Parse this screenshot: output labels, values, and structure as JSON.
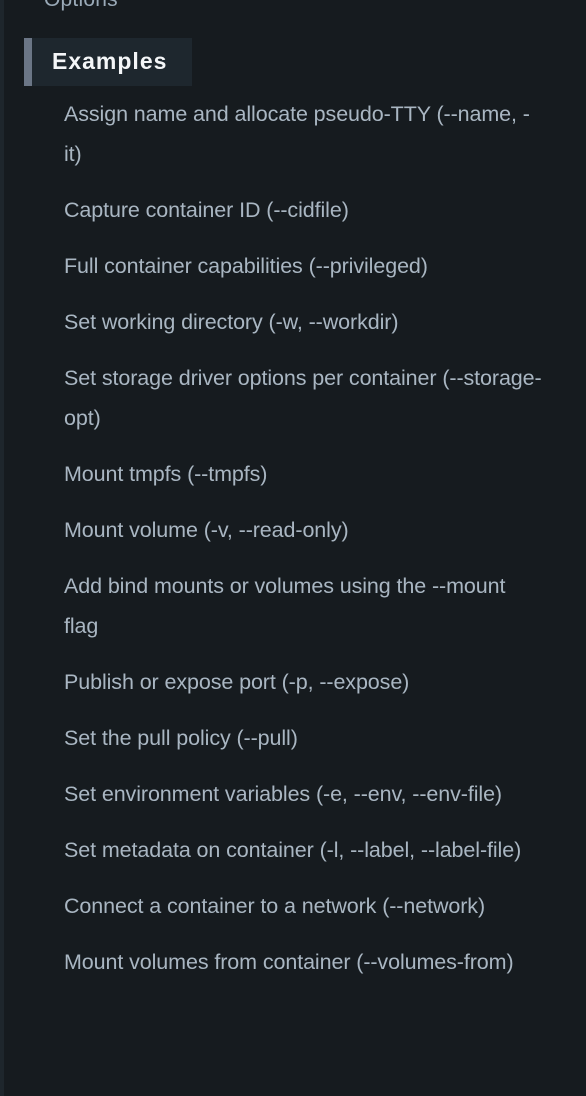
{
  "toc": {
    "previous_item": "Options",
    "active_section": "Examples",
    "sub_items": [
      "Assign name and allocate pseudo-TTY (--name, -it)",
      "Capture container ID (--cidfile)",
      "Full container capabilities (--privileged)",
      "Set working directory (-w, --workdir)",
      "Set storage driver options per container (--storage-opt)",
      "Mount tmpfs (--tmpfs)",
      "Mount volume (-v, --read-only)",
      "Add bind mounts or volumes using the --mount flag",
      "Publish or expose port (-p, --expose)",
      "Set the pull policy (--pull)",
      "Set environment variables (-e, --env, --env-file)",
      "Set metadata on container (-l, --label, --label-file)",
      "Connect a container to a network (--network)",
      "Mount volumes from container (--volumes-from)"
    ]
  },
  "colors": {
    "background": "#161b1f",
    "active_bg": "#1e272e",
    "active_accent": "#6b7686",
    "active_text": "#f4f6f8",
    "link_text": "#a9b6c2"
  }
}
